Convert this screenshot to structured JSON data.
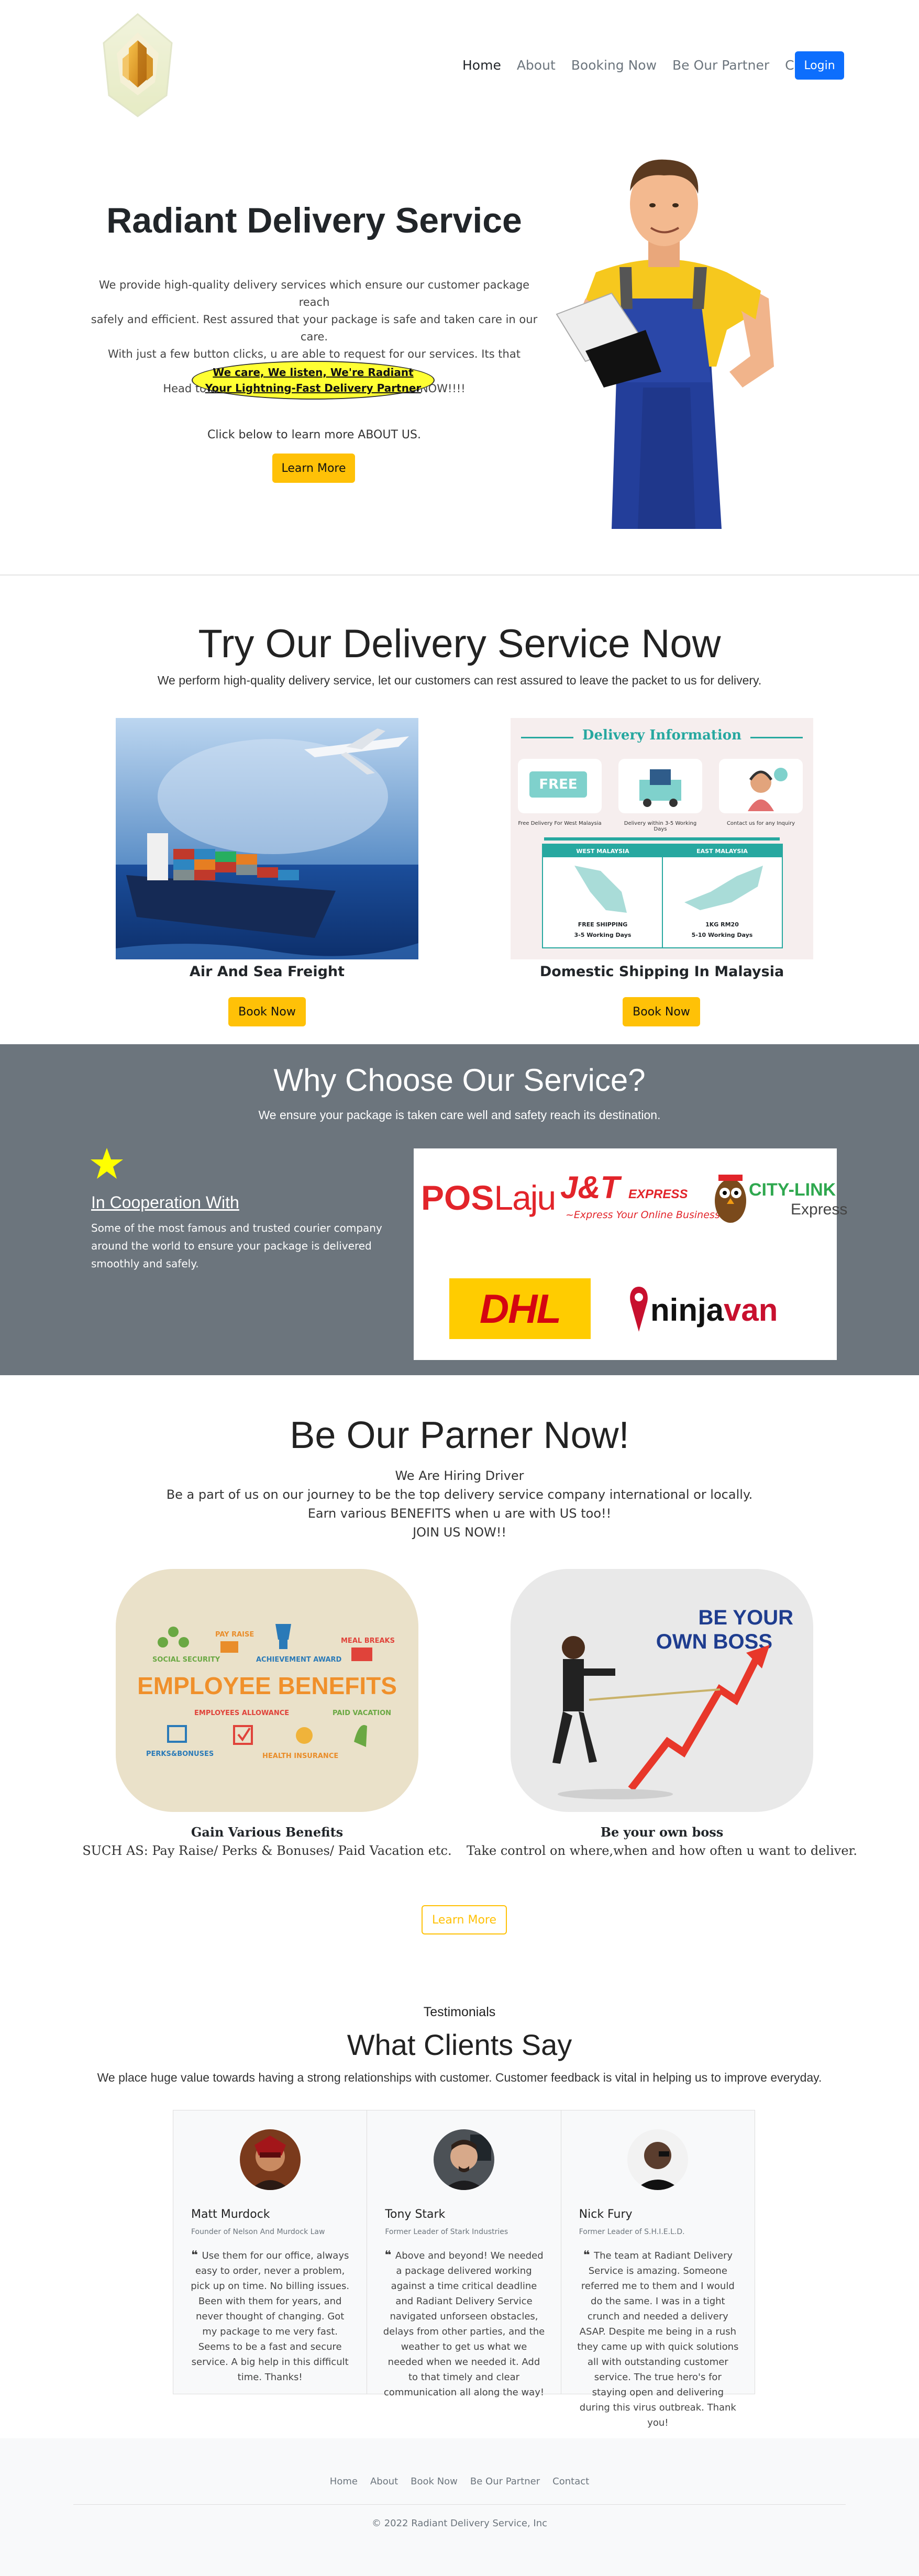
{
  "nav": {
    "links": [
      "Home",
      "About",
      "Booking Now",
      "Be Our Partner",
      "Contact"
    ],
    "login": "Login"
  },
  "hero": {
    "title": "Radiant Delivery Service",
    "lines": [
      "We provide high-quality delivery services which ensure our customer package reach",
      "safely and efficient. Rest assured that your package is safe and taken care in our care.",
      "With just a few button clicks, u are able to request for our services. Its that easy!!",
      "Head to the service section below and TRY US NOW!!!!"
    ],
    "badge_line1": "We care, We listen, We're Radiant",
    "badge_line2": "Your Lightning-Fast Delivery Partner",
    "cta_text": "Click below to learn more ABOUT US.",
    "learn_more": "Learn More"
  },
  "delivery": {
    "title": "Try Our Delivery Service Now",
    "subtitle": "We perform high-quality delivery service, let our customers can rest assured to leave the packet to us for delivery.",
    "cards": [
      {
        "title": "Air And Sea Freight",
        "button": "Book Now"
      },
      {
        "title": "Domestic Shipping In Malaysia",
        "button": "Book Now"
      }
    ],
    "info": {
      "heading": "Delivery Information",
      "free": "FREE",
      "f1": "Free Delivery For West Malaysia",
      "f2": "Delivery within 3-5 Working Days",
      "f3": "Contact us for any Inquiry",
      "west": "WEST MALAYSIA",
      "east": "EAST MALAYSIA",
      "west_fee": "FREE SHIPPING",
      "east_fee": "1KG RM20",
      "west_days": "3-5 Working Days",
      "east_days": "5-10 Working Days"
    }
  },
  "why": {
    "title": "Why Choose Our Service?",
    "subtitle": "We ensure your package is taken care well and safety reach its destination.",
    "coop_title": "In Cooperation With",
    "coop_text": "Some of the most famous and trusted courier company around the world to ensure your package is delivered smoothly and safely.",
    "logos": {
      "poslaju_a": "POS",
      "poslaju_b": "Laju",
      "jt": "J&T",
      "jt_express": "EXPRESS",
      "jt_slogan": "~Express Your Online Business~",
      "citylink": "CITY-LINK",
      "citylink_sub": "Express",
      "dhl": "DHL",
      "ninja": "ninja",
      "van": "van"
    }
  },
  "partner": {
    "title": "Be Our Parner Now!",
    "lines": [
      "We Are Hiring Driver",
      "Be a part of us on our journey to be the top delivery service company international or locally.",
      "Earn various BENEFITS when u are with US too!!",
      "JOIN US NOW!!"
    ],
    "benefits": {
      "heading": "EMPLOYEE BENEFITS",
      "labels": [
        "PAY RAISE",
        "SOCIAL SECURITY",
        "ACHIEVEMENT AWARD",
        "MEAL BREAKS",
        "EMPLOYEES ALLOWANCE",
        "PAID VACATION",
        "PERKS&BONUSES",
        "HEALTH INSURANCE"
      ]
    },
    "boss_line1": "BE YOUR",
    "boss_line2": "OWN BOSS",
    "cards": [
      {
        "title": "Gain Various Benefits",
        "text": "SUCH AS: Pay Raise/ Perks & Bonuses/ Paid Vacation etc."
      },
      {
        "title": "Be your own boss",
        "text": "Take control on where,when and how often u want to deliver."
      }
    ],
    "learn_more": "Learn More"
  },
  "testimonials": {
    "eyebrow": "Testimonials",
    "title": "What Clients Say",
    "subtitle": "We place huge value towards having a strong relationships with customer. Customer feedback is vital in helping us to improve everyday.",
    "items": [
      {
        "name": "Matt Murdock",
        "role": "Founder of Nelson And Murdock Law",
        "quote": "Use them for our office, always easy to order, never a problem, pick up on time. No billing issues. Been with them for years, and never thought of changing. Got my package to me very fast. Seems to be a fast and secure service. A big help in this difficult time. Thanks!"
      },
      {
        "name": "Tony Stark",
        "role": "Former Leader of Stark Industries",
        "quote": "Above and beyond! We needed a package delivered working against a time critical deadline and Radiant Delivery Service navigated unforseen obstacles, delays from other parties, and the weather to get us what we needed when we needed it. Add to that timely and clear communication all along the way!"
      },
      {
        "name": "Nick Fury",
        "role": "Former Leader of S.H.I.E.L.D.",
        "quote": "The team at Radiant Delivery Service is amazing. Someone referred me to them and I would do the same. I was in a tight crunch and needed a delivery ASAP. Despite me being in a rush they came up with quick solutions all with outstanding customer service. The true hero's for staying open and delivering during this virus outbreak. Thank you!"
      }
    ]
  },
  "footer": {
    "links": [
      "Home",
      "About",
      "Book Now",
      "Be Our Partner",
      "Contact"
    ],
    "copyright": "© 2022 Radiant Delivery Service, Inc"
  }
}
